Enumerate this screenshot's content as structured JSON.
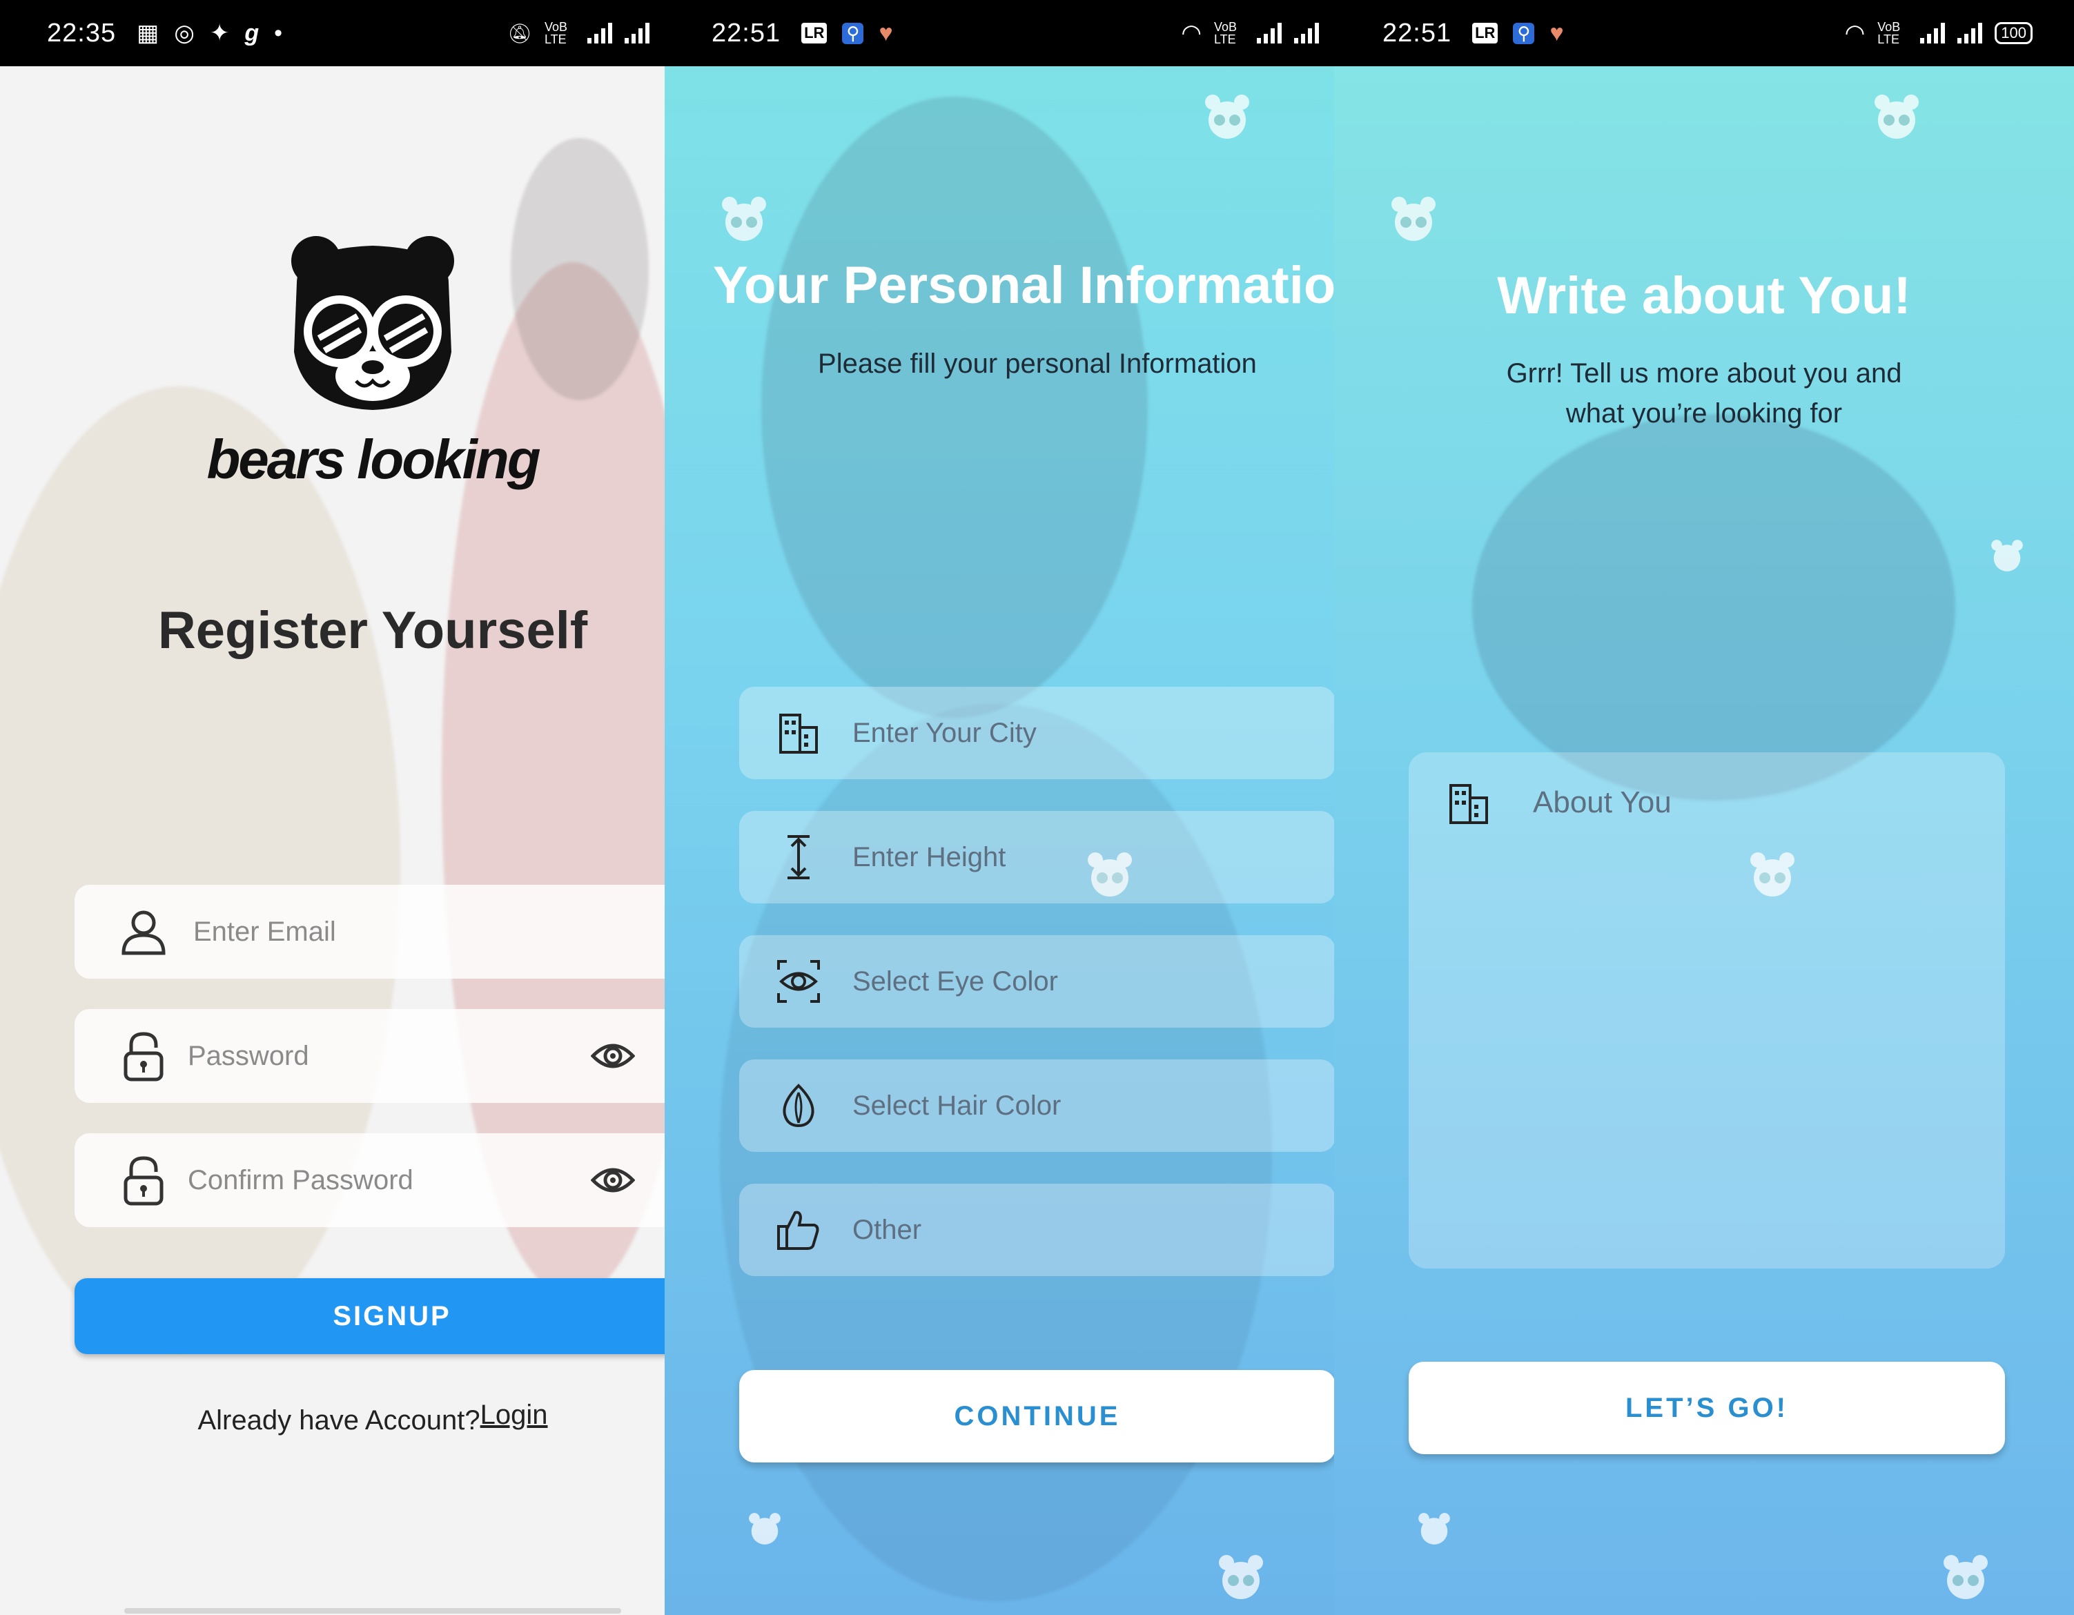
{
  "screens": [
    {
      "status": {
        "time": "22:35",
        "icons": [
          "calendar-icon",
          "instagram-icon",
          "twitter-icon",
          "g-icon"
        ],
        "right_text": "VoB LTE"
      },
      "brand": {
        "name": "bears looking"
      },
      "title": "Register Yourself",
      "fields": {
        "email_placeholder": "Enter Email",
        "password_placeholder": "Password",
        "confirm_placeholder": "Confirm Password"
      },
      "signup_label": "SIGNUP",
      "footer": {
        "prompt": "Already have Account?",
        "login_link": "Login"
      }
    },
    {
      "status": {
        "time": "22:51",
        "icons": [
          "lr-icon",
          "usb-icon",
          "heart-icon"
        ],
        "right_text": "VoB LTE"
      },
      "title": "Your Personal Informatior",
      "subtitle": "Please fill your personal Information",
      "fields": {
        "city": "Enter Your City",
        "height": "Enter Height",
        "eye": "Select Eye Color",
        "hair": "Select Hair Color",
        "other": "Other"
      },
      "continue_label": "CONTINUE"
    },
    {
      "status": {
        "time": "22:51",
        "icons": [
          "lr-icon",
          "usb-icon",
          "heart-icon"
        ],
        "right_text": "VoB LTE",
        "battery": "100"
      },
      "title": "Write about You!",
      "subtitle_line1": "Grrr! Tell us more about you and",
      "subtitle_line2": "what you’re looking for",
      "about_placeholder": "About You",
      "go_label": "LET’S GO!"
    }
  ],
  "colors": {
    "primary": "#2196f3",
    "button_text_blue": "#2a8fd0"
  }
}
